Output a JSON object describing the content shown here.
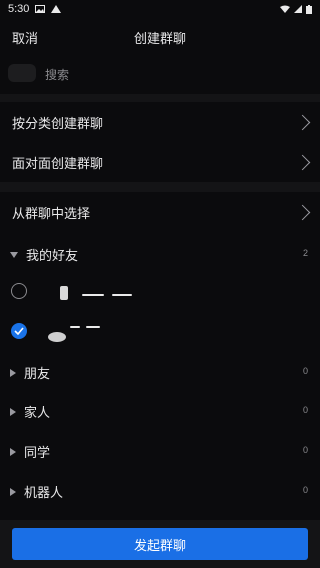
{
  "status_bar": {
    "time": "5:30"
  },
  "header": {
    "cancel_label": "取消",
    "title": "创建群聊"
  },
  "search": {
    "placeholder": "搜索"
  },
  "options": [
    {
      "label": "按分类创建群聊"
    },
    {
      "label": "面对面创建群聊"
    },
    {
      "label": "从群聊中选择"
    }
  ],
  "groups": [
    {
      "label": "我的好友",
      "count": "2",
      "expanded": true
    },
    {
      "label": "朋友",
      "count": "0",
      "expanded": false
    },
    {
      "label": "家人",
      "count": "0",
      "expanded": false
    },
    {
      "label": "同学",
      "count": "0",
      "expanded": false
    },
    {
      "label": "机器人",
      "count": "0",
      "expanded": false
    }
  ],
  "contacts": [
    {
      "checked": false
    },
    {
      "checked": true
    }
  ],
  "primary_button": {
    "label": "发起群聊"
  },
  "colors": {
    "accent": "#1a73e8",
    "background": "#0b0b0d",
    "divider": "#141416"
  }
}
